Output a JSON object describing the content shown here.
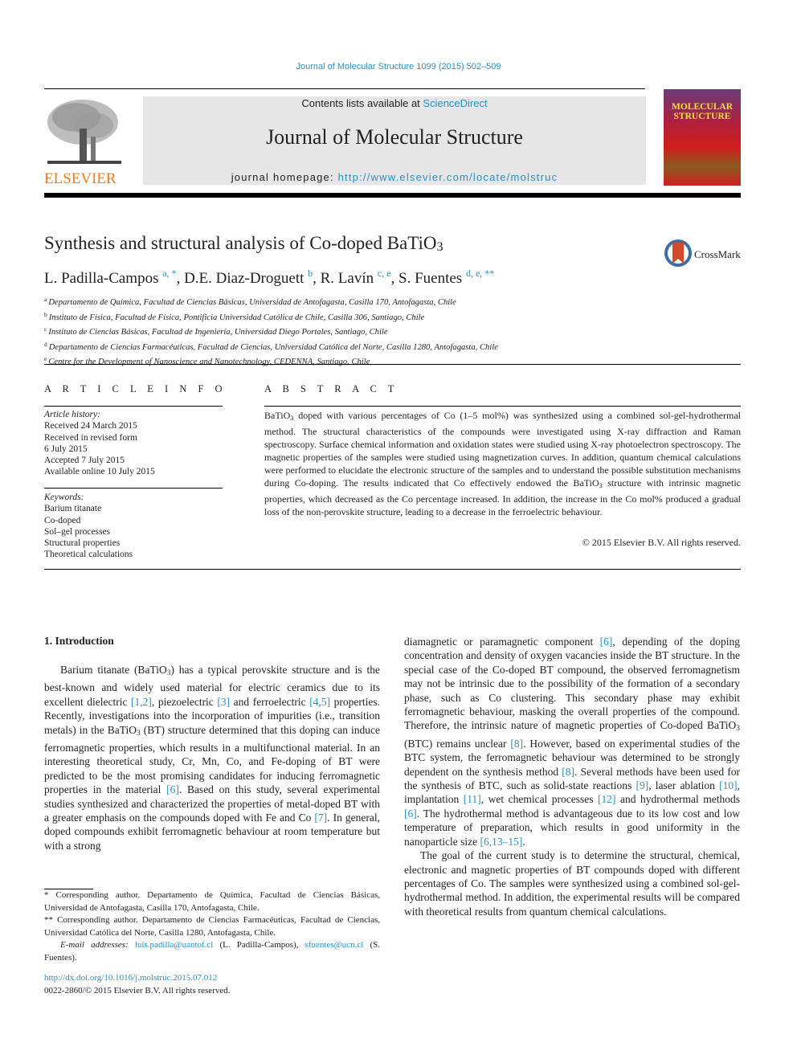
{
  "header": {
    "running_citation": "Journal of Molecular Structure 1099 (2015) 502–509",
    "contents_prefix": "Contents lists available at ",
    "contents_link": "ScienceDirect",
    "journal_title": "Journal of Molecular Structure",
    "homepage_prefix": "journal homepage: ",
    "homepage_url": "http://www.elsevier.com/locate/molstruc",
    "publisher_logo": "ELSEVIER",
    "cover_title_line1": "MOLECULAR",
    "cover_title_line2": "STRUCTURE",
    "crossmark_label": "CrossMark"
  },
  "article": {
    "title_main": "Synthesis and structural analysis of Co-doped BaTiO",
    "title_sub": "3",
    "authors": [
      {
        "name": "L. Padilla-Campos",
        "sup": "a, *"
      },
      {
        "name": "D.E. Diaz-Droguett",
        "sup": "b"
      },
      {
        "name": "R. Lavín",
        "sup": "c, e"
      },
      {
        "name": "S. Fuentes",
        "sup": "d, e, **"
      }
    ],
    "affiliations": [
      {
        "key": "a",
        "text": "Departamento de Química, Facultad de Ciencias Básicas, Universidad de Antofagasta, Casilla 170, Antofagasta, Chile"
      },
      {
        "key": "b",
        "text": "Instituto de Física, Facultad de Física, Pontificia Universidad Católica de Chile, Casilla 306, Santiago, Chile"
      },
      {
        "key": "c",
        "text": "Instituto de Ciencias Básicas, Facultad de Ingeniería, Universidad Diego Portales, Santiago, Chile"
      },
      {
        "key": "d",
        "text": "Departamento de Ciencias Farmacéuticas, Facultad de Ciencias, Universidad Católica del Norte, Casilla 1280, Antofagasta, Chile"
      },
      {
        "key": "e",
        "text": "Centre for the Development of Nanoscience and Nanotechnology, CEDENNA, Santiago, Chile"
      }
    ]
  },
  "article_info": {
    "heading": "A R T I C L E   I N F O",
    "history_label": "Article history:",
    "history": [
      "Received 24 March 2015",
      "Received in revised form",
      "6 July 2015",
      "Accepted 7 July 2015",
      "Available online 10 July 2015"
    ],
    "keywords_label": "Keywords:",
    "keywords": [
      "Barium titanate",
      "Co-doped",
      "Sol–gel processes",
      "Structural properties",
      "Theoretical calculations"
    ]
  },
  "abstract": {
    "heading": "A B S T R A C T",
    "p1": "BaTiO",
    "p2": " doped with various percentages of Co (1–5 mol%) was synthesized using a combined sol-gel-hydrothermal method. The structural characteristics of the compounds were investigated using X-ray diffraction and Raman spectroscopy. Surface chemical information and oxidation states were studied using X-ray photoelectron spectroscopy. The magnetic properties of the samples were studied using magnetization curves. In addition, quantum chemical calculations were performed to elucidate the electronic structure of the samples and to understand the possible substitution mechanisms during Co-doping. The results indicated that Co effectively endowed the BaTiO",
    "p3": " structure with intrinsic magnetic properties, which decreased as the Co percentage increased. In addition, the increase in the Co mol% produced a gradual loss of the non-perovskite structure, leading to a decrease in the ferroelectric behaviour.",
    "sub": "3",
    "copyright": "© 2015 Elsevier B.V. All rights reserved."
  },
  "intro": {
    "heading": "1.  Introduction",
    "left": {
      "a": "Barium titanate (BaTiO",
      "b": ") has a typical perovskite structure and is the best-known and widely used material for electric ceramics due to its excellent dielectric ",
      "r1": "[1,2]",
      "c": ", piezoelectric ",
      "r2": "[3]",
      "d": " and ferroelectric ",
      "r3": "[4,5]",
      "e": " properties. Recently, investigations into the incorporation of impurities (i.e., transition metals) in the BaTiO",
      "f": " (BT) structure determined that this doping can induce ferromagnetic properties, which results in a multifunctional material. In an interesting theoretical study, Cr, Mn, Co, and Fe-doping of BT were predicted to be the most promising candidates for inducing ferromagnetic properties in the material ",
      "r4": "[6]",
      "g": ". Based on this study, several experimental studies synthesized and characterized the properties of metal-doped BT with a greater emphasis on the compounds doped with Fe and Co ",
      "r5": "[7]",
      "h": ". In general, doped compounds exhibit ferromagnetic behaviour at room temperature but with a strong"
    },
    "right": {
      "a": "diamagnetic or paramagnetic component ",
      "r1": "[6]",
      "b": ", depending of the doping concentration and density of oxygen vacancies inside the BT structure. In the special case of the Co-doped BT compound, the observed ferromagnetism may not be intrinsic due to the possibility of the formation of a secondary phase, such as Co clustering. This secondary phase may exhibit ferromagnetic behaviour, masking the overall properties of the compound. Therefore, the intrinsic nature of magnetic properties of Co-doped BaTiO",
      "c": " (BTC) remains unclear ",
      "r2": "[8]",
      "d": ". However, based on experimental studies of the BTC system, the ferromagnetic behaviour was determined to be strongly dependent on the synthesis method ",
      "r3": "[8]",
      "e": ". Several methods have been used for the synthesis of BTC, such as solid-state reactions ",
      "r4": "[9]",
      "f": ", laser ablation ",
      "r5": "[10]",
      "g": ", implantation ",
      "r6": "[11]",
      "h": ", wet chemical processes ",
      "r7": "[12]",
      "i": " and hydrothermal methods ",
      "r8": "[6]",
      "j": ". The hydrothermal method is advantageous due to its low cost and low temperature of preparation, which results in good uniformity in the nanoparticle size ",
      "r9": "[6,13–15]",
      "k": ".",
      "p2": "The goal of the current study is to determine the structural, chemical, electronic and magnetic properties of BT compounds doped with different percentages of Co. The samples were synthesized using a combined sol-gel-hydrothermal method. In addition, the experimental results will be compared with theoretical results from quantum chemical calculations."
    },
    "sub": "3"
  },
  "footnotes": {
    "fn1": " * Corresponding author. Departamento de Química, Facultad de Ciencias Básicas, Universidad de Antofagasta, Casilla 170, Antofagasta, Chile.",
    "fn2": " ** Corresponding author. Departamento de Ciencias Farmacéuticas, Facultad de Ciencias, Universidad Católica del Norte, Casilla 1280, Antofagasta, Chile.",
    "email_label": "E-mail addresses:",
    "email1": "luis.padilla@uantof.cl",
    "email1_owner": " (L. Padilla-Campos), ",
    "email2": "sfuentes@ucn.cl",
    "email2_owner": " (S. Fuentes).",
    "doi": "http://dx.doi.org/10.1016/j.molstruc.2015.07.012",
    "issn": "0022-2860/© 2015 Elsevier B.V. All rights reserved."
  }
}
